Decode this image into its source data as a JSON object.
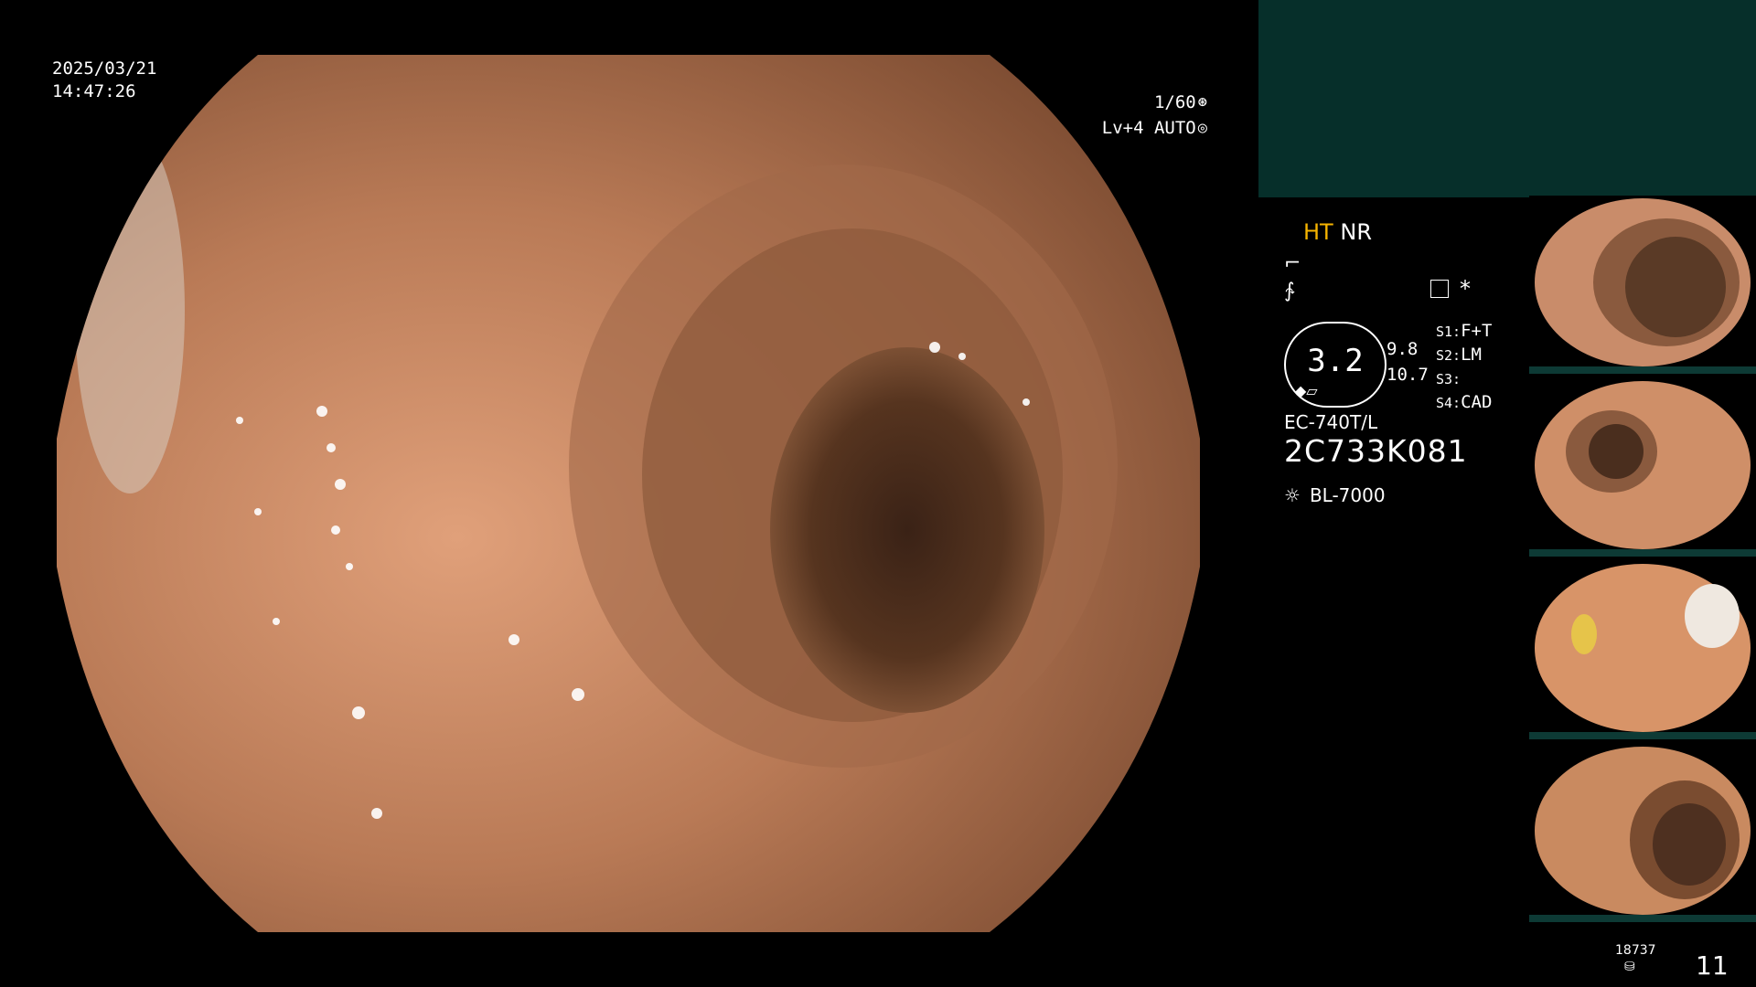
{
  "timestamp": {
    "date": "2025/03/21",
    "time": "14:47:26"
  },
  "exposure": {
    "shutter": "1/60",
    "shutter_icon": "aperture-icon",
    "level": "Lv+4 AUTO",
    "level_icon": "iris-icon"
  },
  "modes": {
    "ht": "HT",
    "nr": "NR"
  },
  "scope": {
    "diameter": "3.2",
    "dim1": "9.8",
    "dim2": "10.7",
    "model": "EC-740T/L",
    "serial": "2C733K081",
    "light_source": "BL-7000",
    "light_icon": "sun-icon"
  },
  "settings": [
    {
      "key": "S1:",
      "value": "F+T"
    },
    {
      "key": "S2:",
      "value": "LM"
    },
    {
      "key": "S3:",
      "value": ""
    },
    {
      "key": "S4:",
      "value": "CAD"
    }
  ],
  "footer": {
    "count": "18737",
    "page": "11",
    "db_icon": "database-icon"
  },
  "colors": {
    "highlight": "#f6b400",
    "teal": "#062f2a",
    "mucosa": "#b5785a"
  }
}
